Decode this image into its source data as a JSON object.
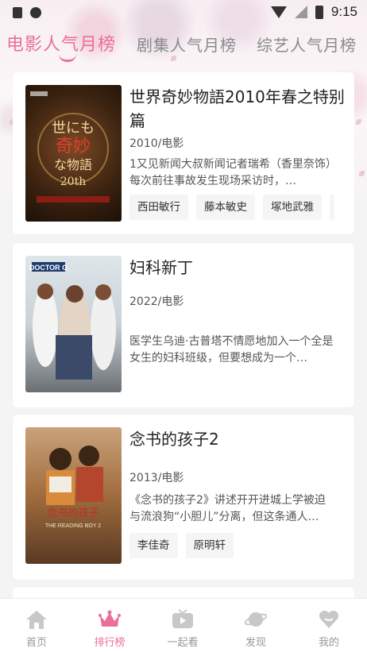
{
  "status_bar": {
    "time": "9:15"
  },
  "tabs": [
    {
      "label": "电影人气月榜",
      "active": true
    },
    {
      "label": "剧集人气月榜",
      "active": false
    },
    {
      "label": "综艺人气月榜",
      "active": false
    }
  ],
  "items": [
    {
      "title": "世界奇妙物語2010年春之特别篇",
      "meta": "2010/电影",
      "description": "1又见新闻大叔新闻记者瑞希（香里奈饰）每次前往事故发生现场采访时，…",
      "actors": [
        "西田敏行",
        "藤本敏史",
        "塚地武雅"
      ],
      "poster_text": "世にも奇妙な物語 20th"
    },
    {
      "title": "妇科新丁",
      "meta": "2022/电影",
      "description": "医学生乌迪·古普塔不情愿地加入一个全是女生的妇科班级，但要想成为一个…",
      "actors": [],
      "poster_text": "DOCTOR G"
    },
    {
      "title": "念书的孩子2",
      "meta": "2013/电影",
      "description": "《念书的孩子2》讲述开开进城上学被迫与流浪狗“小胆儿”分离，但这条通人…",
      "actors": [
        "李佳奇",
        "原明轩"
      ],
      "poster_text": "THE READING BOY 2"
    }
  ],
  "bottom_nav": [
    {
      "label": "首页",
      "icon": "home-icon",
      "active": false
    },
    {
      "label": "排行榜",
      "icon": "crown-icon",
      "active": true
    },
    {
      "label": "一起看",
      "icon": "tv-icon",
      "active": false
    },
    {
      "label": "发现",
      "icon": "planet-icon",
      "active": false
    },
    {
      "label": "我的",
      "icon": "heart-icon",
      "active": false
    }
  ],
  "colors": {
    "accent": "#ec6f98",
    "inactive": "#8a8a8a"
  }
}
